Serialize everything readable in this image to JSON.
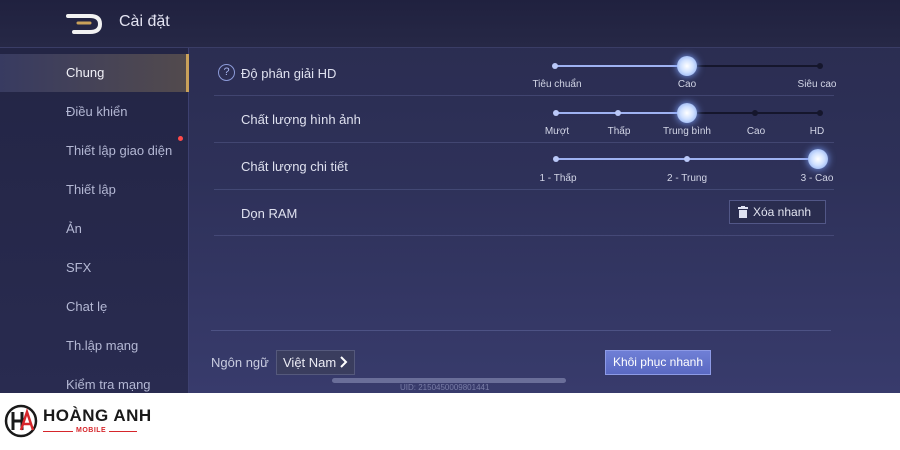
{
  "header": {
    "title": "Cài đặt"
  },
  "sidebar": {
    "items": [
      {
        "label": "Chung",
        "active": true
      },
      {
        "label": "Điều khiển"
      },
      {
        "label": "Thiết lập giao diện",
        "has_notification": true
      },
      {
        "label": "Thiết lập"
      },
      {
        "label": "Ản"
      },
      {
        "label": "SFX"
      },
      {
        "label": "Chat lẹ"
      },
      {
        "label": "Th.lập mạng"
      },
      {
        "label": "Kiểm tra mạng"
      }
    ]
  },
  "settings": {
    "resolution": {
      "label": "Độ phân giải HD",
      "options": [
        "Tiêu chuẩn",
        "Cao",
        "Siêu cao"
      ],
      "selected_index": 1
    },
    "graphics": {
      "label": "Chất lượng hình ảnh",
      "options": [
        "Mượt",
        "Thấp",
        "Trung bình",
        "Cao",
        "HD"
      ],
      "selected_index": 2
    },
    "detail": {
      "label": "Chất lượng chi tiết",
      "options": [
        "1 - Thấp",
        "2 - Trung",
        "3 - Cao"
      ],
      "selected_index": 2
    },
    "ram": {
      "label": "Dọn RAM",
      "button_label": "Xóa nhanh"
    }
  },
  "footer": {
    "language_label": "Ngôn ngữ",
    "language_value": "Việt Nam",
    "restore_label": "Khôi phục nhanh",
    "uid_text": "UID: 2150450009801441"
  },
  "brand": {
    "name": "HOÀNG ANH",
    "subtitle": "MOBILE"
  },
  "colors": {
    "accent": "#9fb2f2",
    "restore_button": "#6576cf",
    "active_border": "#c9a15a",
    "brand_red": "#d6262b"
  },
  "icons": {
    "back": "back-arrow-icon",
    "help": "help-icon",
    "trash": "trash-icon",
    "chevron": "chevron-right-icon",
    "logo": "brand-logo-icon"
  }
}
